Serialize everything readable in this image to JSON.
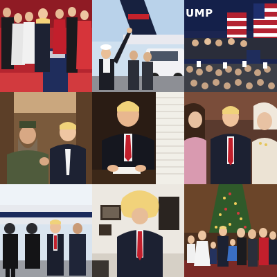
{
  "collage": {
    "rows": 3,
    "columns": 3
  },
  "tiles": [
    {
      "subject": "podium-group-photo"
    },
    {
      "subject": "jet-tarmac-wave"
    },
    {
      "subject": "rally-crowd-stage",
      "sign_text": "UMP"
    },
    {
      "subject": "plane-cabin-portrait"
    },
    {
      "subject": "desk-signing-documents"
    },
    {
      "subject": "seated-interview-trio"
    },
    {
      "subject": "police-officers-group"
    },
    {
      "subject": "mirror-selfie-hair-prop"
    },
    {
      "subject": "christmas-family-photo"
    }
  ]
}
